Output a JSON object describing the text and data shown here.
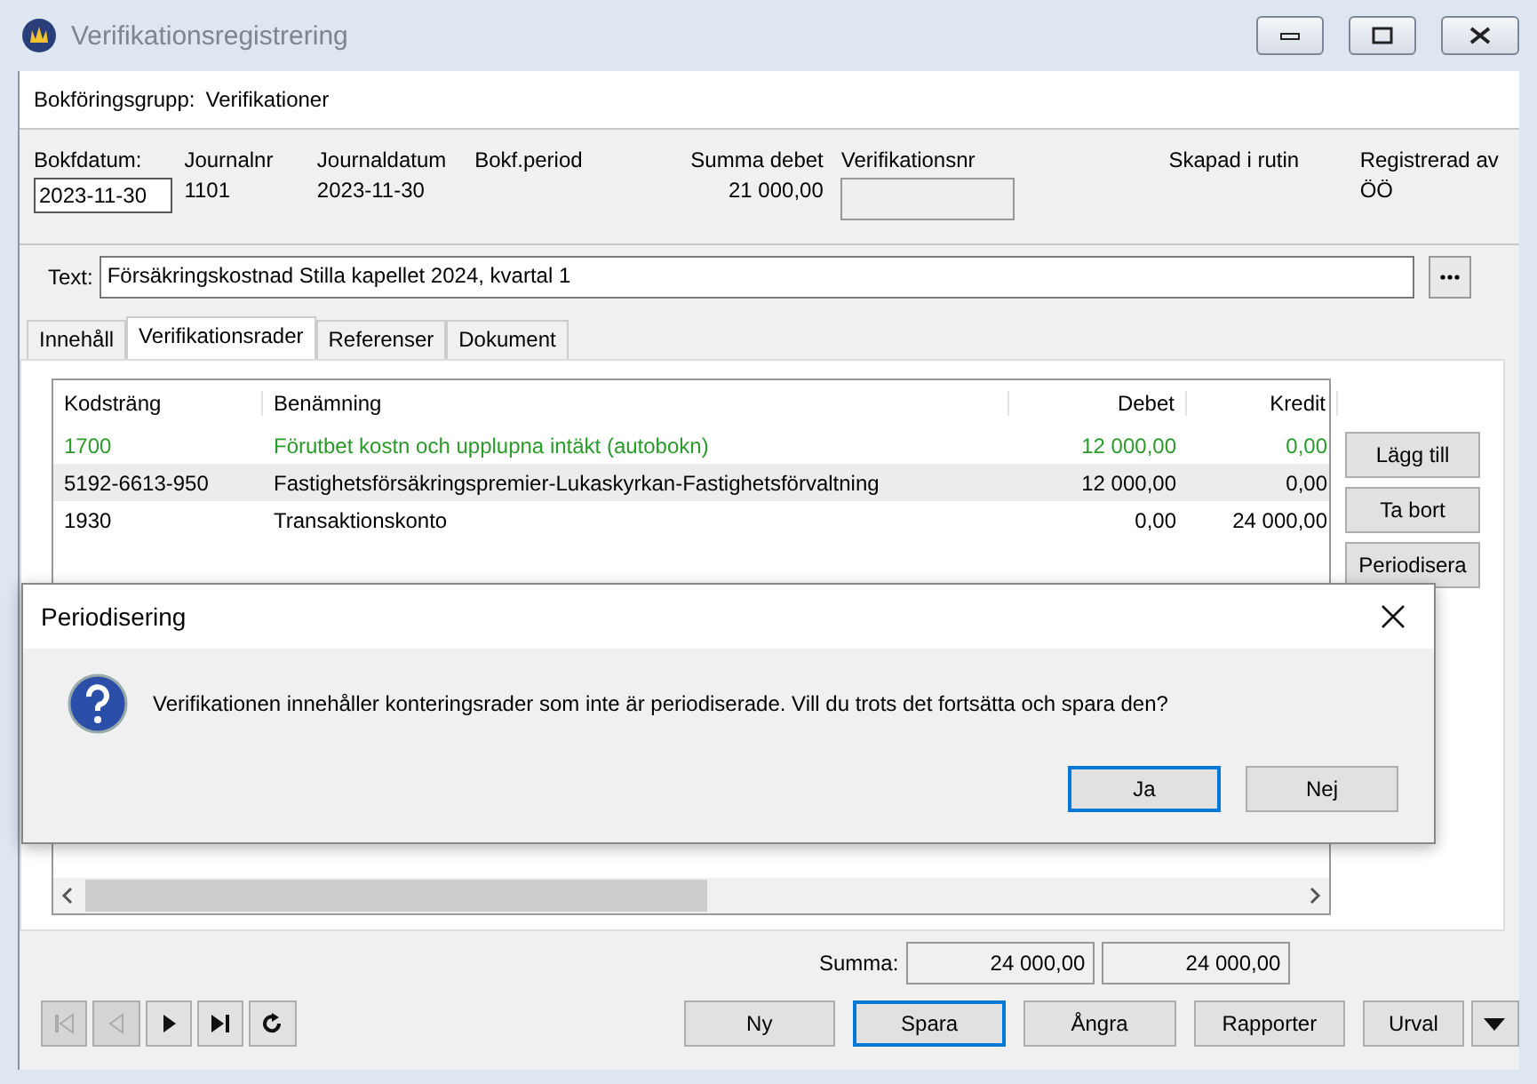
{
  "window": {
    "title": "Verifikationsregistrering"
  },
  "group": {
    "label": "Bokföringsgrupp:",
    "value": "Verifikationer"
  },
  "header_fields": [
    {
      "label": "Bokfdatum:",
      "value": "2023-11-30",
      "kind": "input"
    },
    {
      "label": "Journalnr",
      "value": "1101",
      "kind": "text"
    },
    {
      "label": "Journaldatum",
      "value": "2023-11-30",
      "kind": "text"
    },
    {
      "label": "Bokf.period",
      "kind": "text"
    },
    {
      "label": "Summa debet",
      "value": "21 000,00",
      "kind": "number"
    },
    {
      "label": "Verifikationsnr",
      "kind": "readonly"
    },
    {
      "label": "Skapad i rutin",
      "kind": "text"
    },
    {
      "label": "Registrerad av",
      "value": "ÖÖ",
      "kind": "text"
    }
  ],
  "text_field": {
    "label": "Text:",
    "value": "Försäkringskostnad Stilla kapellet 2024, kvartal 1"
  },
  "tabs": [
    {
      "label": "Innehåll",
      "selected": false
    },
    {
      "label": "Verifikationsrader",
      "selected": true
    },
    {
      "label": "Referenser",
      "selected": false
    },
    {
      "label": "Dokument",
      "selected": false
    }
  ],
  "table": {
    "columns": [
      "Kodsträng",
      "Benämning",
      "Debet",
      "Kredit"
    ],
    "rows": [
      {
        "kind": "auto",
        "selected": false,
        "cells": [
          "1700",
          "Förutbet kostn och upplupna intäkt (autobokn)",
          "12 000,00",
          "0,00"
        ]
      },
      {
        "kind": "normal",
        "selected": true,
        "cells": [
          "5192-6613-950",
          "Fastighetsförsäkringspremier-Lukaskyrkan-Fastighetsförvaltning",
          "12 000,00",
          "0,00"
        ]
      },
      {
        "kind": "normal",
        "selected": false,
        "cells": [
          "1930",
          "Transaktionskonto",
          "0,00",
          "24 000,00"
        ]
      }
    ]
  },
  "side_buttons": [
    "Lägg till",
    "Ta bort",
    "Periodisera"
  ],
  "totals": {
    "label": "Summa:",
    "debet": "24 000,00",
    "kredit": "24 000,00"
  },
  "nav_buttons": [
    {
      "kind": "first",
      "disabled": true
    },
    {
      "kind": "prev",
      "disabled": true
    },
    {
      "kind": "next",
      "disabled": false
    },
    {
      "kind": "last",
      "disabled": false
    },
    {
      "kind": "refresh",
      "disabled": false
    }
  ],
  "toolbar_buttons": [
    {
      "label": "Ny",
      "default": false
    },
    {
      "label": "Spara",
      "default": true
    },
    {
      "label": "Ångra",
      "default": false
    },
    {
      "label": "Rapporter",
      "default": false
    },
    {
      "label": "Urval",
      "default": false
    }
  ],
  "dialog": {
    "title": "Periodisering",
    "message": "Verifikationen innehåller konteringsrader som inte är periodiserade. Vill du trots det fortsätta och spara den?",
    "buttons": [
      {
        "label": "Ja",
        "focused": true
      },
      {
        "label": "Nej",
        "focused": false
      }
    ]
  }
}
